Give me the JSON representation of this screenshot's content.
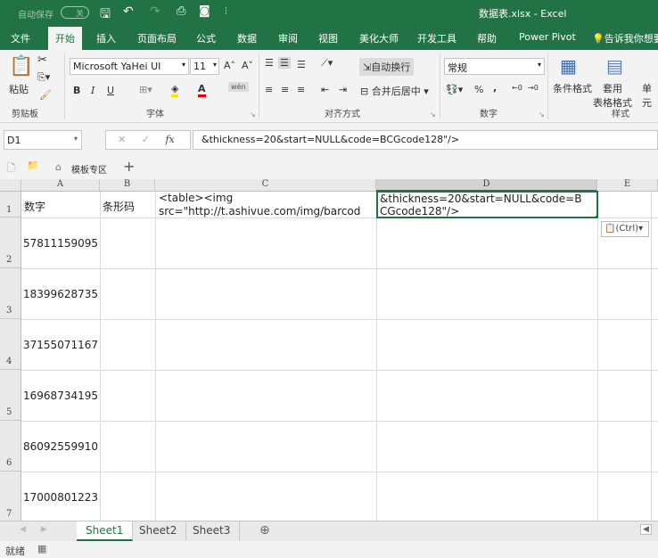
{
  "titlebar": {
    "autosave": "自动保存",
    "autosave_state": "关",
    "title": "数据表.xlsx  -  Excel"
  },
  "ribbon_tabs": [
    "文件",
    "开始",
    "插入",
    "页面布局",
    "公式",
    "数据",
    "审阅",
    "视图",
    "美化大师",
    "开发工具",
    "帮助",
    "Power Pivot",
    "告诉我你想要"
  ],
  "active_tab": "开始",
  "ribbon": {
    "clipboard": {
      "paste": "粘贴",
      "label": "剪贴板"
    },
    "font": {
      "name": "Microsoft YaHei UI",
      "size": "11",
      "bold": "B",
      "italic": "I",
      "underline": "U",
      "label": "字体",
      "phonetic": "wén"
    },
    "alignment": {
      "wrap": "自动换行",
      "merge": "合并后居中",
      "label": "对齐方式"
    },
    "number": {
      "format": "常规",
      "percent": "%",
      "comma": ",",
      "label": "数字"
    },
    "styles": {
      "conditional": "条件格式",
      "table": "套用\n表格格式",
      "cell": "单元",
      "label": "样式"
    }
  },
  "formula_bar": {
    "name_box": "D1",
    "fx": "fx",
    "content": "&thickness=20&start=NULL&code=BCGcode128\"/>"
  },
  "quick_bar": {
    "template": "模板专区",
    "add": "+"
  },
  "columns": [
    "A",
    "B",
    "C",
    "D",
    "E"
  ],
  "rows": [
    {
      "num": "1",
      "a": "数字",
      "b": "条形码",
      "c": "<table><img\nsrc=\"http://t.ashivue.com/img/barcod",
      "d1": "&thickness=20&start=NULL&code=B",
      "d2": "CGcode128\"/>"
    },
    {
      "num": "2",
      "a": "57811159095"
    },
    {
      "num": "3",
      "a": "18399628735"
    },
    {
      "num": "4",
      "a": "37155071167"
    },
    {
      "num": "5",
      "a": "16968734195"
    },
    {
      "num": "6",
      "a": "86092559910"
    },
    {
      "num": "7",
      "a": "17000801223"
    }
  ],
  "paste_options": "(Ctrl)",
  "sheets": [
    "Sheet1",
    "Sheet2",
    "Sheet3"
  ],
  "active_sheet": "Sheet1",
  "status": {
    "ready": "就绪"
  },
  "colors": {
    "brand": "#217346",
    "selection": "#217346"
  }
}
